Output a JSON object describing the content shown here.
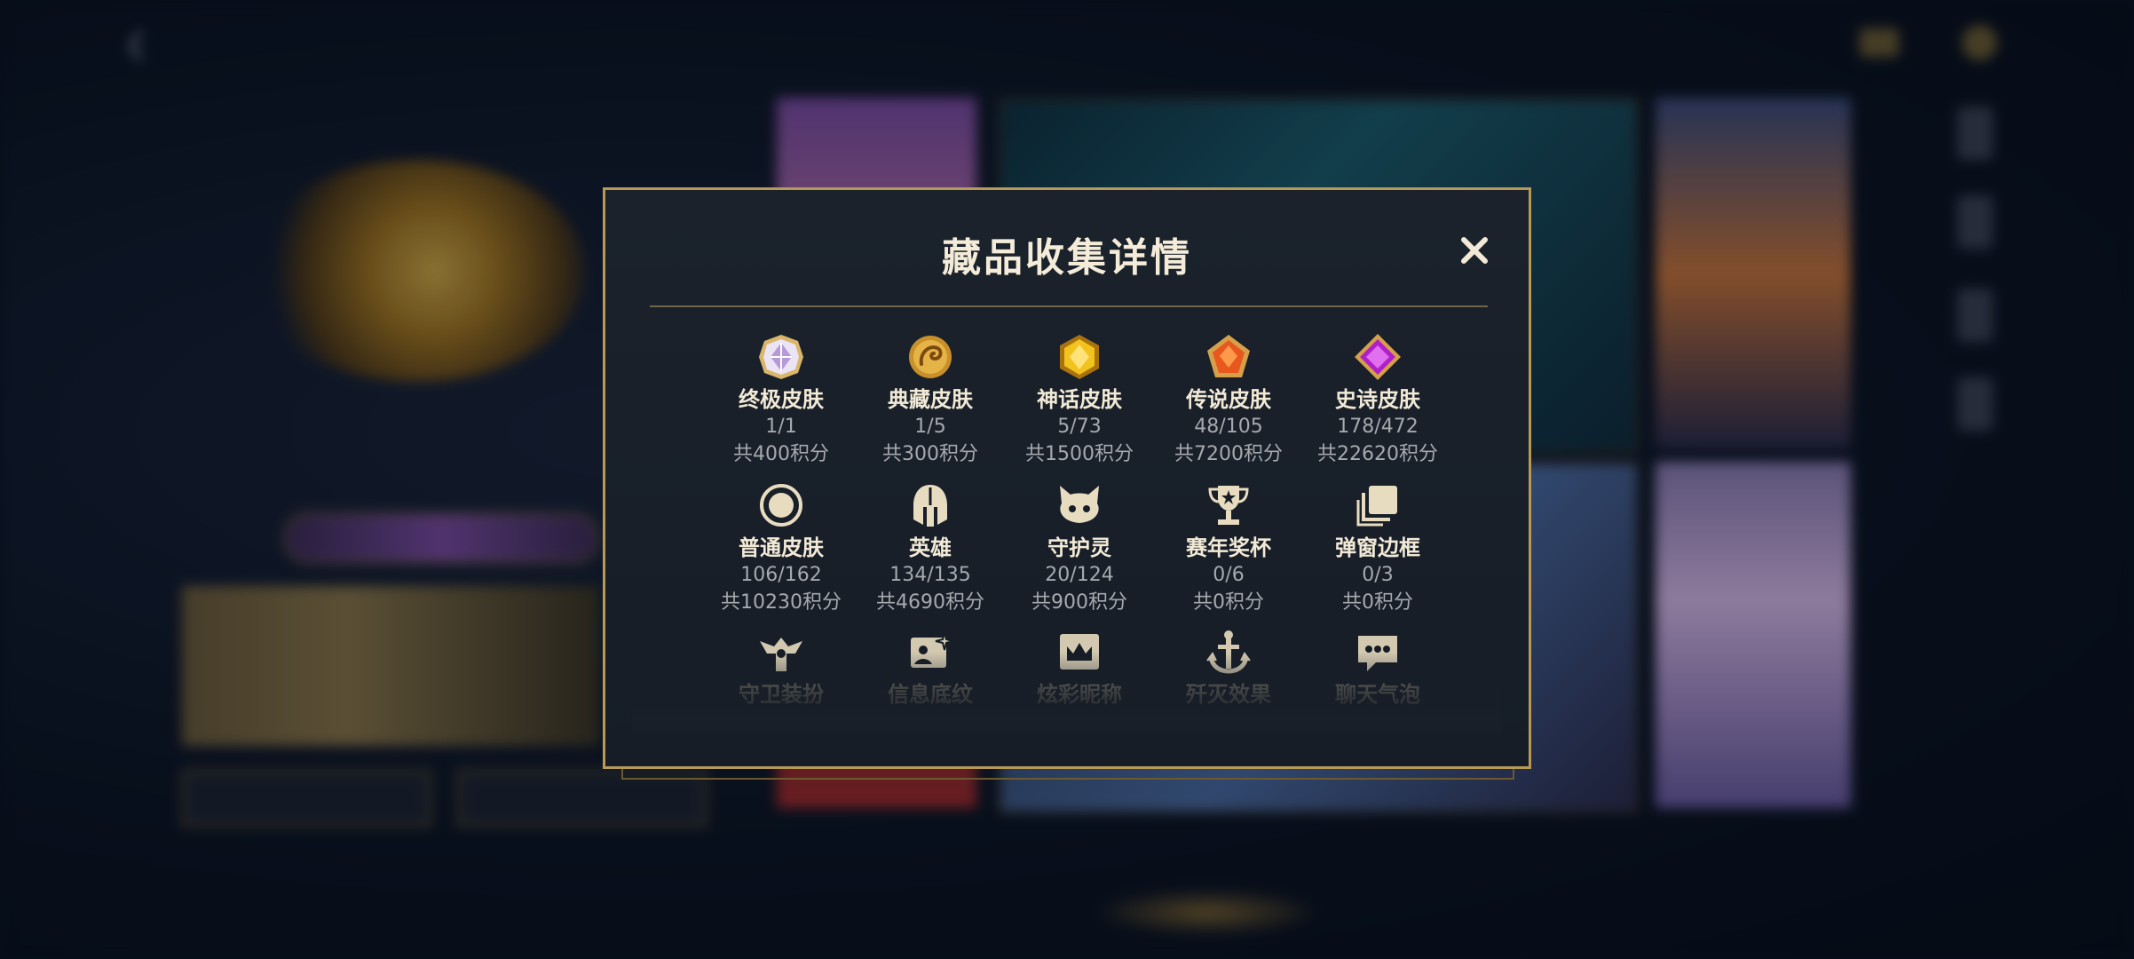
{
  "background": {
    "colors": {
      "accent_gold": "#b79a58",
      "panel": "#1b222c"
    }
  },
  "modal": {
    "title": "藏品收集详情",
    "close_icon": "close-icon",
    "items": [
      {
        "icon": "ultimate-skin-icon",
        "name": "终极皮肤",
        "count": "1/1",
        "points": "共400积分"
      },
      {
        "icon": "treasure-skin-icon",
        "name": "典藏皮肤",
        "count": "1/5",
        "points": "共300积分"
      },
      {
        "icon": "mythic-skin-icon",
        "name": "神话皮肤",
        "count": "5/73",
        "points": "共1500积分"
      },
      {
        "icon": "legendary-skin-icon",
        "name": "传说皮肤",
        "count": "48/105",
        "points": "共7200积分"
      },
      {
        "icon": "epic-skin-icon",
        "name": "史诗皮肤",
        "count": "178/472",
        "points": "共22620积分"
      },
      {
        "icon": "normal-skin-icon",
        "name": "普通皮肤",
        "count": "106/162",
        "points": "共10230积分"
      },
      {
        "icon": "hero-helmet-icon",
        "name": "英雄",
        "count": "134/135",
        "points": "共4690积分"
      },
      {
        "icon": "guardian-spirit-icon",
        "name": "守护灵",
        "count": "20/124",
        "points": "共900积分"
      },
      {
        "icon": "season-trophy-icon",
        "name": "赛年奖杯",
        "count": "0/6",
        "points": "共0积分"
      },
      {
        "icon": "popup-frame-icon",
        "name": "弹窗边框",
        "count": "0/3",
        "points": "共0积分"
      },
      {
        "icon": "guard-outfit-icon",
        "name": "守卫装扮"
      },
      {
        "icon": "info-pattern-icon",
        "name": "信息底纹"
      },
      {
        "icon": "colorful-name-icon",
        "name": "炫彩昵称"
      },
      {
        "icon": "kill-effect-icon",
        "name": "歼灭效果"
      },
      {
        "icon": "chat-bubble-icon",
        "name": "聊天气泡"
      }
    ]
  }
}
